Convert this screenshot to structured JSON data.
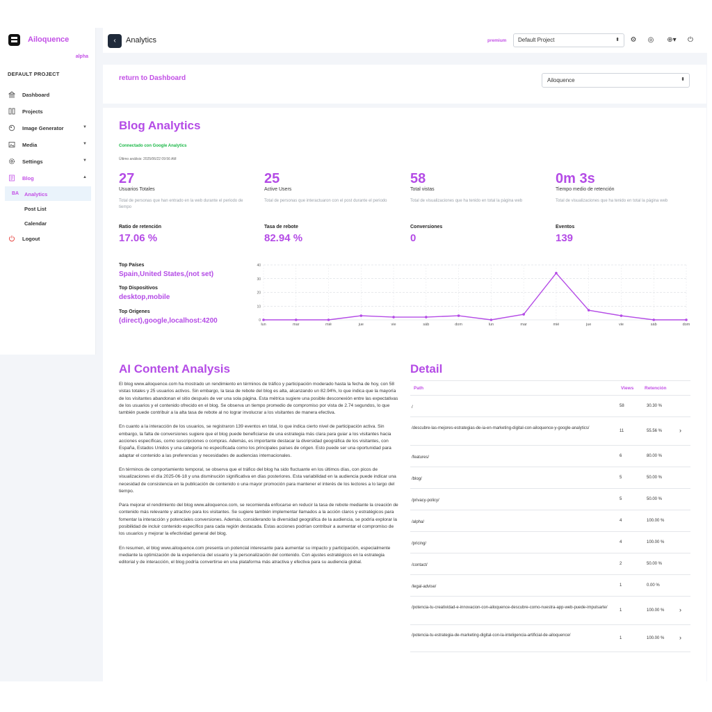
{
  "sidebar": {
    "brand": "Ailoquence",
    "tag": "alpha",
    "project": "DEFAULT PROJECT",
    "items": [
      {
        "label": "Dashboard",
        "icon": "bank-icon"
      },
      {
        "label": "Projects",
        "icon": "columns-icon"
      },
      {
        "label": "Image Generator",
        "icon": "image-gen-icon"
      },
      {
        "label": "Media",
        "icon": "media-icon"
      },
      {
        "label": "Settings",
        "icon": "gear-icon"
      },
      {
        "label": "Blog",
        "icon": "blog-icon"
      }
    ],
    "blog_sub": [
      {
        "abbr": "BA",
        "label": "Analytics"
      },
      {
        "label": "Post List"
      },
      {
        "label": "Calendar"
      }
    ],
    "logout": "Logout"
  },
  "header": {
    "title": "Analytics",
    "plan": "premium",
    "project_select": "Default Project"
  },
  "controls": {
    "return_link": "return to Dashboard",
    "site_select": "Ailoquence"
  },
  "blog": {
    "title": "Blog Analytics",
    "connected": "Connectado con Google Analytics",
    "last_analysis": "Último análisis: 2025/06/22 09:56 AM",
    "stats": [
      {
        "value": "27",
        "name": "Usuarios Totales",
        "desc": "Total de personas que han entrado en la web durante el periodo de tiempo"
      },
      {
        "value": "25",
        "name": "Active Users",
        "desc": "Total de personas que interactuaron con el post durante el periodo"
      },
      {
        "value": "58",
        "name": "Total vistas",
        "desc": "Total de visualizaciones que ha tenido en total la página web"
      },
      {
        "value": "0m 3s",
        "name": "Tiempo medio de retención",
        "desc": "Total de visualizaciones que ha tenido en total la página web"
      }
    ],
    "kpis": [
      {
        "name": "Ratio de retención",
        "value": "17.06 %"
      },
      {
        "name": "Tasa de rebote",
        "value": "82.94 %"
      },
      {
        "name": "Conversiones",
        "value": "0"
      },
      {
        "name": "Eventos",
        "value": "139"
      }
    ],
    "top_countries_label": "Top Países",
    "top_countries": "Spain,United States,(not set)",
    "top_devices_label": "Top Dispositivos",
    "top_devices": "desktop,mobile",
    "top_origins_label": "Top Origenes",
    "top_origins": "(direct),google,localhost:4200"
  },
  "chart_data": {
    "type": "line",
    "categories": [
      "lun",
      "mar",
      "mié",
      "jue",
      "vie",
      "sáb",
      "dom",
      "lun",
      "mar",
      "mié",
      "jue",
      "vie",
      "sáb",
      "dom"
    ],
    "values": [
      0,
      0,
      0,
      3,
      2,
      2,
      3,
      0,
      4,
      34,
      7,
      3,
      0,
      0
    ],
    "ylim": [
      0,
      40
    ],
    "yticks": [
      0,
      10,
      20,
      30,
      40
    ],
    "color": "#b44be6",
    "grid": true
  },
  "ai": {
    "title": "AI Content Analysis",
    "paragraphs": [
      "El blog www.ailoquence.com ha mostrado un rendimiento en términos de tráfico y participación moderado hasta la fecha de hoy, con 58 vistas totales y 25 usuarios activos. Sin embargo, la tasa de rebote del blog es alta, alcanzando un 82.94%, lo que indica que la mayoría de los visitantes abandonan el sitio después de ver una sola página. Esta métrica sugiere una posible desconexión entre las expectativas de los usuarios y el contenido ofrecido en el blog. Se observa un tiempo promedio de compromiso por vista de 2.74 segundos, lo que también puede contribuir a la alta tasa de rebote al no lograr involucrar a los visitantes de manera efectiva.",
      "En cuanto a la interacción de los usuarios, se registraron 139 eventos en total, lo que indica cierto nivel de participación activa. Sin embargo, la falta de conversiones sugiere que el blog puede beneficiarse de una estrategia más clara para guiar a los visitantes hacia acciones específicas, como suscripciones o compras. Además, es importante destacar la diversidad geográfica de los visitantes, con España, Estados Unidos y una categoría no especificada como los principales países de origen. Esto puede ser una oportunidad para adaptar el contenido a las preferencias y necesidades de audiencias internacionales.",
      "En términos de comportamiento temporal, se observa que el tráfico del blog ha sido fluctuante en los últimos días, con picos de visualizaciones el día 2025-06-18 y una disminución significativa en días posteriores. Esta variabilidad en la audiencia puede indicar una necesidad de consistencia en la publicación de contenido o una mayor promoción para mantener el interés de los lectores a lo largo del tiempo.",
      "Para mejorar el rendimiento del blog www.ailoquence.com, se recomienda enfocarse en reducir la tasa de rebote mediante la creación de contenido más relevante y atractivo para los visitantes. Se sugiere también implementar llamados a la acción claros y estratégicos para fomentar la interacción y potenciales conversiones. Además, considerando la diversidad geográfica de la audiencia, se podría explorar la posibilidad de incluir contenido específico para cada región destacada. Estas acciones podrían contribuir a aumentar el compromiso de los usuarios y mejorar la efectividad general del blog.",
      "En resumen, el blog www.ailoquence.com presenta un potencial interesante para aumentar su impacto y participación, especialmente mediante la optimización de la experiencia del usuario y la personalización del contenido. Con ajustes estratégicos en la estrategia editorial y de interacción, el blog podría convertirse en una plataforma más atractiva y efectiva para su audiencia global."
    ]
  },
  "detail": {
    "title": "Detail",
    "headers": {
      "path": "Path",
      "views": "Views",
      "retention": "Retención"
    },
    "rows": [
      {
        "path": "/",
        "views": "58",
        "retention": "30.30 %",
        "arrow": ""
      },
      {
        "path": "/descubre-las-mejores-estrategias-de-ia-en-marketing-digital-con-ailoquence-y-google-analytics/",
        "views": "11",
        "retention": "55.56 %",
        "arrow": "›"
      },
      {
        "path": "/features/",
        "views": "6",
        "retention": "80.00 %",
        "arrow": ""
      },
      {
        "path": "/blog/",
        "views": "5",
        "retention": "50.00 %",
        "arrow": ""
      },
      {
        "path": "/privacy-policy/",
        "views": "5",
        "retention": "50.00 %",
        "arrow": ""
      },
      {
        "path": "/alpha/",
        "views": "4",
        "retention": "100.00 %",
        "arrow": ""
      },
      {
        "path": "/pricing/",
        "views": "4",
        "retention": "100.00 %",
        "arrow": ""
      },
      {
        "path": "/contact/",
        "views": "2",
        "retention": "50.00 %",
        "arrow": ""
      },
      {
        "path": "/legal-advise/",
        "views": "1",
        "retention": "0.00 %",
        "arrow": ""
      },
      {
        "path": "/potencia-tu-creatividad-e-innovacion-con-ailoquence-descubre-como-nuestra-app-web-puede-impulsarte/",
        "views": "1",
        "retention": "100.00 %",
        "arrow": "›"
      },
      {
        "path": "/potencia-tu-estrategia-de-marketing-digital-con-la-inteligencia-artificial-de-ailoquence/",
        "views": "1",
        "retention": "100.00 %",
        "arrow": "›"
      }
    ]
  }
}
